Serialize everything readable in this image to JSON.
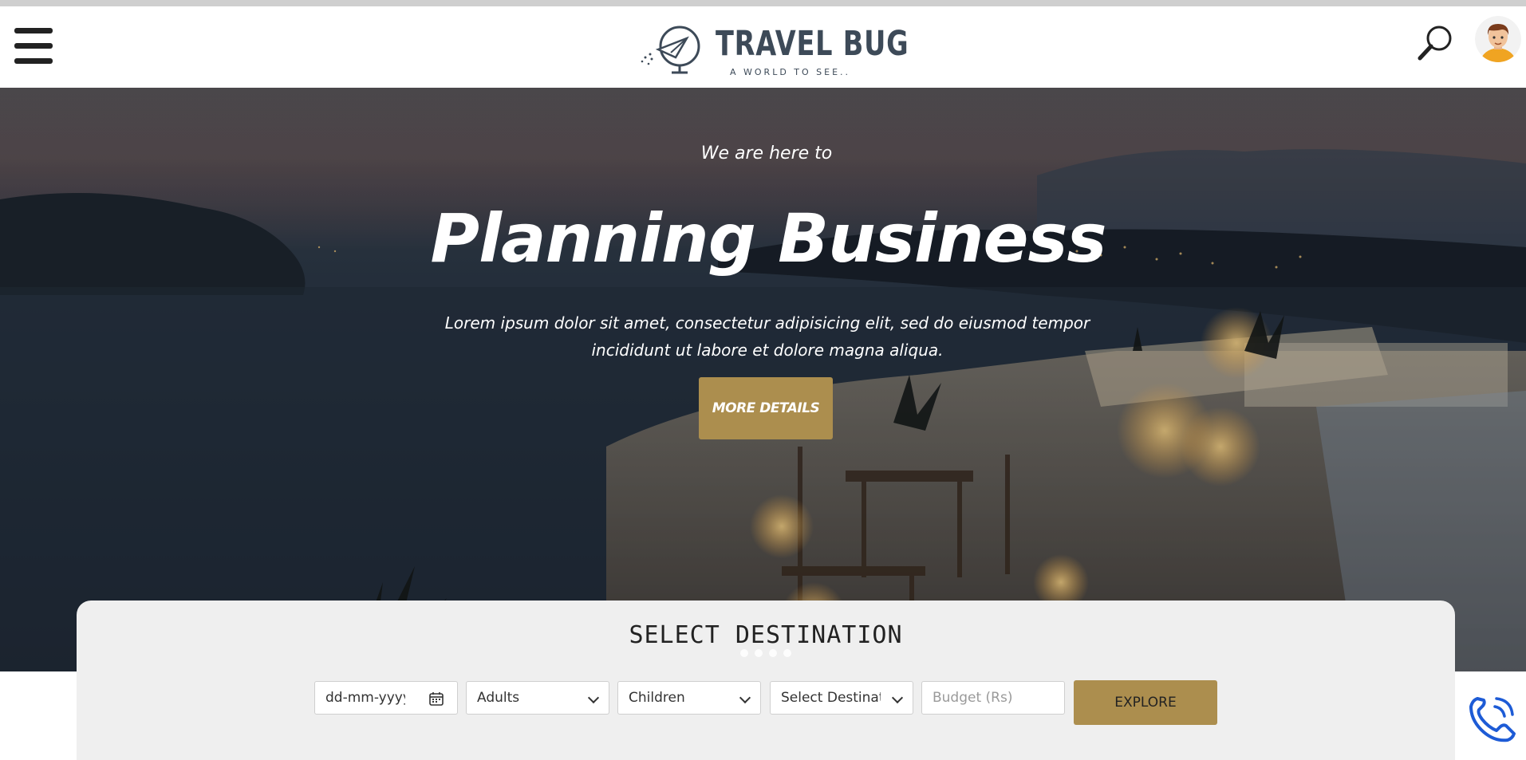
{
  "header": {
    "logo_title": "TRAVEL BUG",
    "logo_tagline": "A WORLD TO SEE..",
    "menu_icon": "hamburger-icon",
    "search_icon": "magnifier-icon",
    "avatar_icon": "user-avatar"
  },
  "hero": {
    "eyebrow": "We are here to",
    "title": "Planning Business",
    "description": "Lorem ipsum dolor sit amet, consectetur adipisicing elit, sed do eiusmod tempor incididunt ut labore et dolore magna aliqua.",
    "button_label": "MORE DETAILS"
  },
  "destination": {
    "title": "SELECT DESTINATION",
    "slides_count": 4,
    "date_placeholder": "dd-mm-yyyy",
    "adults_label": "Adults",
    "children_label": "Children",
    "destination_label": "Select Destination",
    "budget_placeholder": "Budget (Rs)",
    "explore_label": "EXPLORE"
  },
  "colors": {
    "accent": "#ac8e4e",
    "logo_text": "#3d4a58",
    "phone_icon": "#1d5bd6"
  },
  "floating": {
    "phone_icon": "phone-call-icon"
  }
}
